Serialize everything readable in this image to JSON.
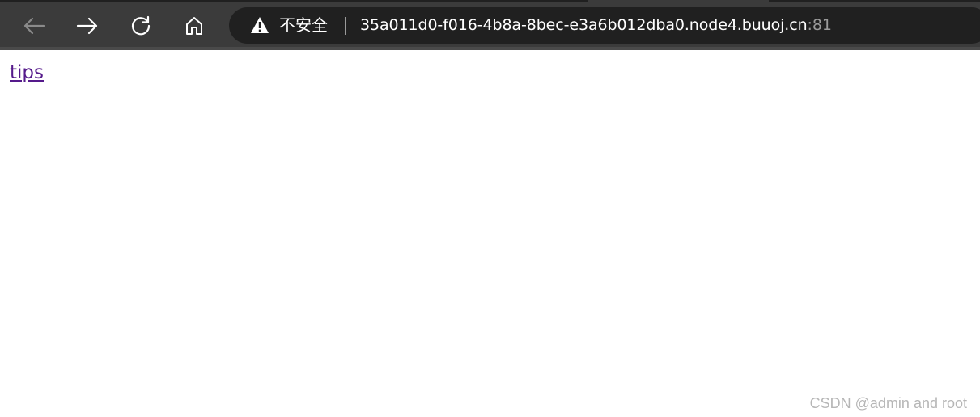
{
  "browser": {
    "nav": {
      "back_icon": "arrow-left-icon",
      "forward_icon": "arrow-right-icon",
      "refresh_icon": "refresh-icon",
      "home_icon": "home-icon"
    },
    "address_bar": {
      "security_icon": "warning-triangle-icon",
      "security_label": "不安全",
      "url_host": "35a011d0-f016-4b8a-8bec-e3a6b012dba0.node4.buuoj.cn",
      "url_port": ":81"
    },
    "colors": {
      "chrome_bg": "#3b3b3b",
      "address_bar_bg": "#202020",
      "link_visited": "#551a8b"
    }
  },
  "page": {
    "link_text": "tips"
  },
  "watermark": {
    "text": "CSDN @admin and root"
  }
}
